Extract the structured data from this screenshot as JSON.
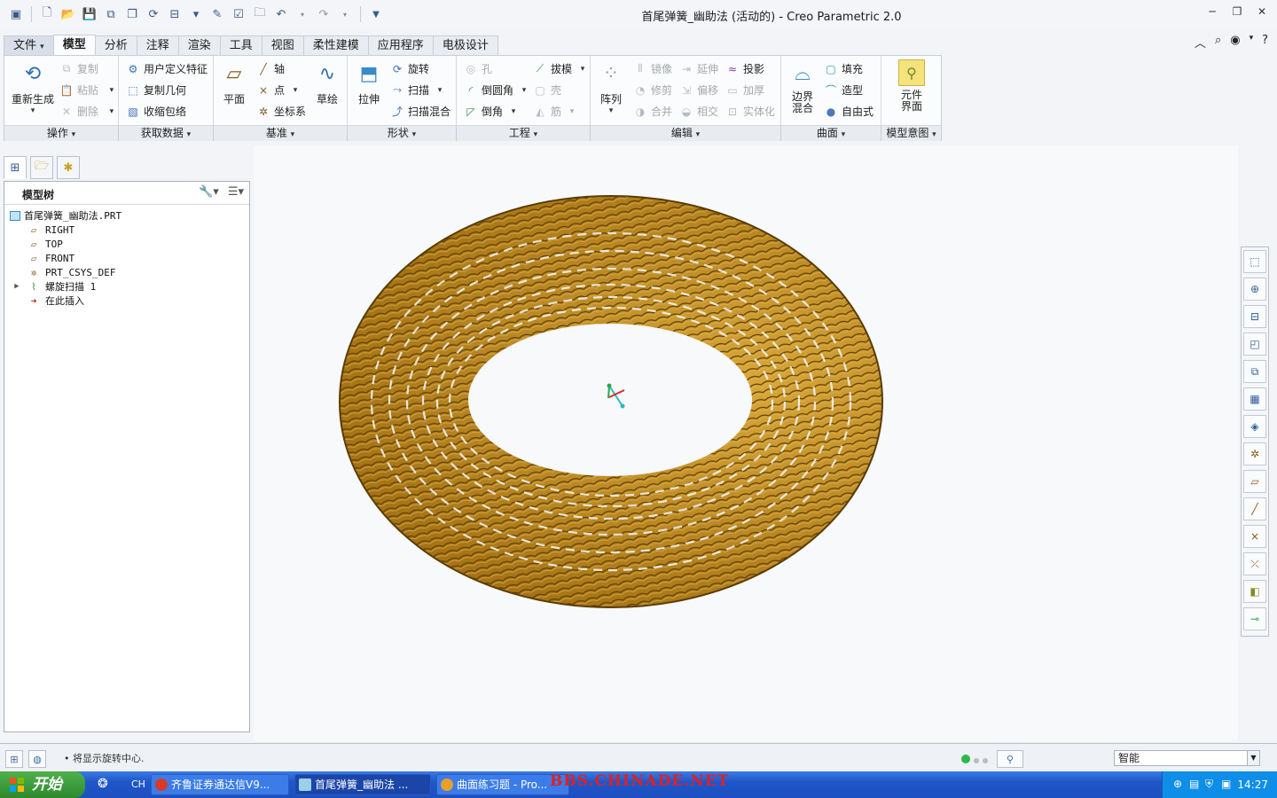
{
  "window": {
    "title": "首尾弹簧_幽助法 (活动的) - Creo Parametric 2.0"
  },
  "ribbon_tabs": [
    "文件",
    "模型",
    "分析",
    "注释",
    "渲染",
    "工具",
    "视图",
    "柔性建模",
    "应用程序",
    "电极设计"
  ],
  "ribbon": {
    "groups": {
      "operations": "操作",
      "get_data": "获取数据",
      "datum": "基准",
      "shape": "形状",
      "engineering": "工程",
      "edit": "编辑",
      "surface": "曲面",
      "model_intent": "模型意图"
    },
    "regenerate": "重新生成",
    "copy": "复制",
    "paste": "粘贴",
    "delete": "删除",
    "udf": "用户定义特征",
    "copy_geom": "复制几何",
    "shrinkwrap": "收缩包络",
    "plane": "平面",
    "axis": "轴",
    "point": "点",
    "csys": "坐标系",
    "sketch": "草绘",
    "extrude": "拉伸",
    "revolve": "旋转",
    "sweep": "扫描",
    "swept_blend": "扫描混合",
    "hole": "孔",
    "round": "倒圆角",
    "chamfer": "倒角",
    "draft": "拔模",
    "shell": "壳",
    "rib": "筋",
    "pattern": "阵列",
    "mirror": "镜像",
    "trim": "修剪",
    "merge": "合并",
    "extend": "延伸",
    "offset": "偏移",
    "intersect": "相交",
    "project": "投影",
    "thicken": "加厚",
    "solidify": "实体化",
    "boundary_blend": "边界混合",
    "fill": "填充",
    "style": "造型",
    "freestyle": "自由式",
    "component_interface": "元件界面"
  },
  "model_tree": {
    "title": "模型树",
    "items": [
      {
        "label": "首尾弹簧_幽助法.PRT",
        "icon": "part-icon",
        "indent": 0
      },
      {
        "label": "RIGHT",
        "icon": "datum-plane-icon",
        "indent": 1
      },
      {
        "label": "TOP",
        "icon": "datum-plane-icon",
        "indent": 1
      },
      {
        "label": "FRONT",
        "icon": "datum-plane-icon",
        "indent": 1
      },
      {
        "label": "PRT_CSYS_DEF",
        "icon": "csys-icon",
        "indent": 1
      },
      {
        "label": "螺旋扫描 1",
        "icon": "helical-sweep-icon",
        "indent": 1
      },
      {
        "label": "在此插入",
        "icon": "insert-here-icon",
        "indent": 1
      }
    ]
  },
  "status": {
    "message": "• 将显示旋转中心.",
    "filter_value": "智能"
  },
  "taskbar": {
    "start": "开始",
    "lang": "CH",
    "items": [
      "齐鲁证券通达信V9...",
      "首尾弹簧_幽助法 ...",
      "曲面练习题 - Pro..."
    ],
    "clock": "14:27",
    "watermark": "BBS.CHINADE.NET"
  },
  "colors": {
    "accent": "#1f56c9",
    "model": "#8a6310",
    "model_highlight": "#c99a2e"
  }
}
